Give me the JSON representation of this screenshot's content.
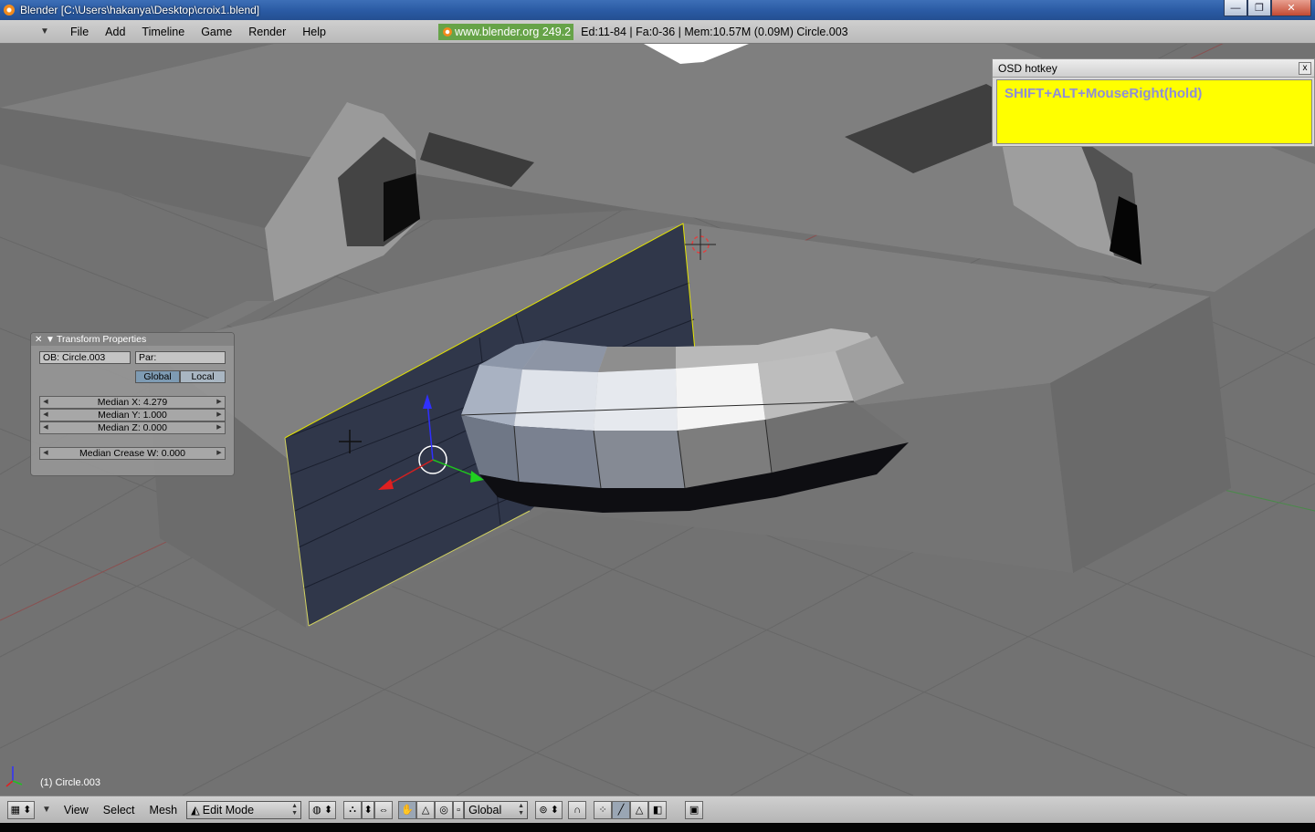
{
  "window": {
    "title": "Blender [C:\\Users\\hakanya\\Desktop\\croix1.blend]",
    "buttons": [
      "—",
      "❐",
      "✕"
    ]
  },
  "header": {
    "menus": [
      "File",
      "Add",
      "Timeline",
      "Game",
      "Render",
      "Help"
    ],
    "site": "www.blender.org 249.2",
    "stats": "Ed:11-84 | Fa:0-36 | Mem:10.57M (0.09M) Circle.003"
  },
  "osd": {
    "title": "OSD hotkey",
    "close": "x",
    "text": "SHIFT+ALT+MouseRight(hold)",
    "colors": {
      "background": "#ffff00",
      "text": "#8e8ed8"
    }
  },
  "transform_panel": {
    "title": "Transform Properties",
    "object": "OB: Circle.003",
    "parent": "Par:",
    "toggle_global": "Global",
    "toggle_local": "Local",
    "median_x": "Median X: 4.279",
    "median_y": "Median Y: 1.000",
    "median_z": "Median Z: 0.000",
    "median_crease": "Median Crease W: 0.000"
  },
  "viewport": {
    "object_label": "(1) Circle.003"
  },
  "toolbar": {
    "menus": [
      "View",
      "Select",
      "Mesh"
    ],
    "mode": "Edit Mode",
    "orientation": "Global"
  }
}
